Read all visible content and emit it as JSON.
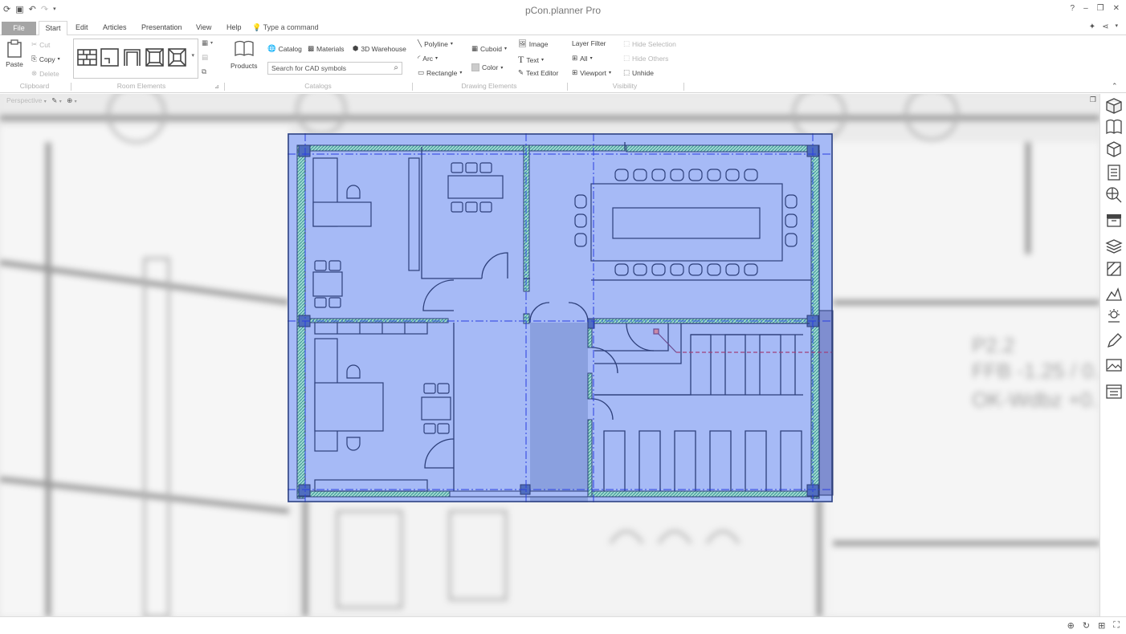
{
  "app": {
    "title": "pCon.planner Pro"
  },
  "tabs": {
    "file": "File",
    "start": "Start",
    "edit": "Edit",
    "articles": "Articles",
    "presentation": "Presentation",
    "view": "View",
    "help": "Help",
    "command": "Type a command"
  },
  "ribbon": {
    "clipboard": {
      "label": "Clipboard",
      "paste": "Paste",
      "cut": "Cut",
      "copy": "Copy",
      "delete": "Delete"
    },
    "room_elements": {
      "label": "Room Elements"
    },
    "catalogs": {
      "label": "Catalogs",
      "products": "Products",
      "catalog": "Catalog",
      "materials": "Materials",
      "warehouse": "3D Warehouse",
      "search_placeholder": "Search for CAD symbols"
    },
    "drawing": {
      "label": "Drawing Elements",
      "polyline": "Polyline",
      "arc": "Arc",
      "rectangle": "Rectangle",
      "cuboid": "Cuboid",
      "color": "Color",
      "image": "Image",
      "text": "Text",
      "text_editor": "Text Editor"
    },
    "visibility": {
      "label": "Visibility",
      "layer_filter": "Layer Filter",
      "all": "All",
      "viewport": "Viewport",
      "hide_selection": "Hide Selection",
      "hide_others": "Hide Others",
      "unhide": "Unhide"
    }
  },
  "canvas": {
    "view": "Perspective"
  },
  "plan_text": {
    "line1": "P2.2",
    "line2": "FFB -1.25 / 0.",
    "line3": "OK-Wdbz +0."
  },
  "colors": {
    "accent": "#4a6cf7",
    "selection": "#6f8ef0",
    "wall_hatch": "#3fb6b6"
  }
}
